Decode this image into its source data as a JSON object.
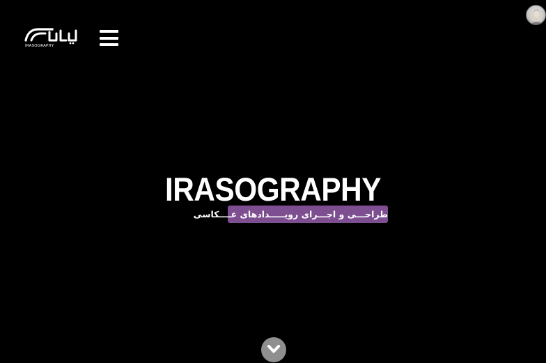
{
  "header": {
    "logo_text": "IRASOGRAPHY",
    "menu_icon": "hamburger-icon"
  },
  "hero": {
    "title": "IRASOGRAPHY",
    "subtitle": "طراحـــی و اجـــرای رویـــــدادهای عــــکاسی"
  },
  "scroll_icon": "chevron-down-icon",
  "colors": {
    "background": "#000000",
    "subtitle_bg": "#7d4f91",
    "scroll_button_bg": "#8f8f8f"
  }
}
